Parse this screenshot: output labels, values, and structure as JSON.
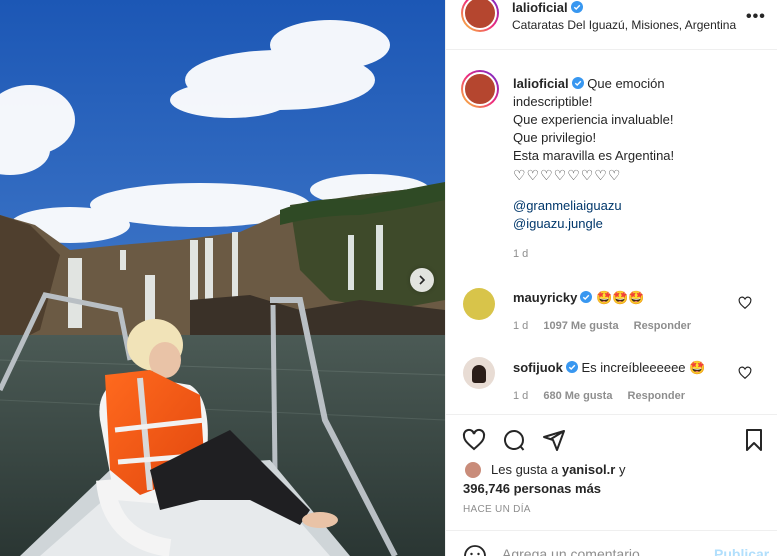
{
  "post": {
    "username": "lalioficial",
    "location": "Cataratas Del Iguazú, Misiones, Argentina",
    "more_label": "•••",
    "caption_lines": [
      "Que emoción",
      "indescriptible!",
      "Que experiencia invaluable!",
      "Que privilegio!",
      "Esta maravilla es Argentina!"
    ],
    "hearts": "♡♡♡♡♡♡♡♡",
    "mentions": [
      "@granmeliaiguazu",
      "@iguazu.jungle"
    ],
    "caption_time": "1 d"
  },
  "comments": [
    {
      "username": "mauyricky",
      "text": "🤩🤩🤩",
      "time": "1 d",
      "likes": "1097 Me gusta",
      "reply": "Responder"
    },
    {
      "username": "sofijuok",
      "text": "Es increíbleeeeee 🤩",
      "time": "1 d",
      "likes": "680 Me gusta",
      "reply": "Responder"
    }
  ],
  "likes": {
    "prefix": "Les gusta a",
    "user": "yanisol.r",
    "suffix": "y",
    "count": "396,746 personas más"
  },
  "ago": "HACE UN DÍA",
  "comment_bar": {
    "placeholder": "Agrega un comentario...",
    "publish": "Publicar"
  },
  "colors": {
    "link": "#00376b",
    "verified": "#3897f0",
    "muted": "#8e8e8e",
    "publish": "#b2dffc"
  }
}
